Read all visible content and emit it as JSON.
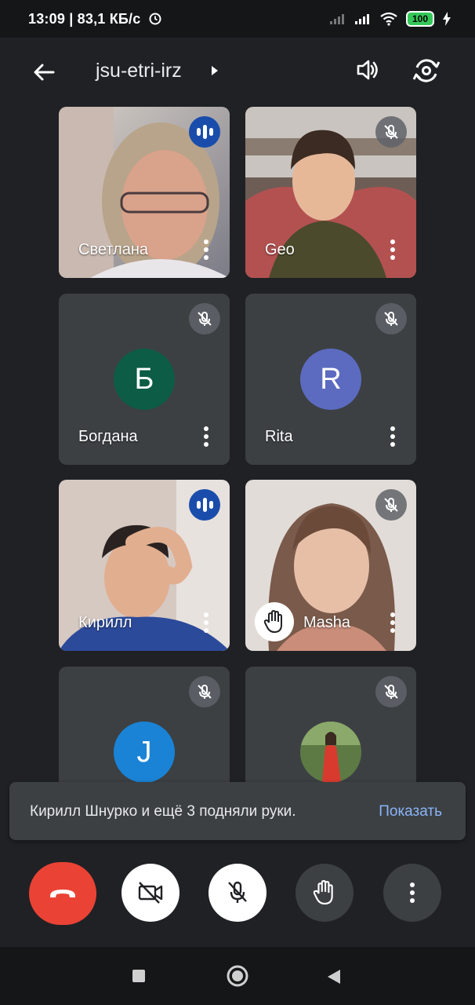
{
  "status_bar": {
    "time_speed": "13:09 | 83,1 КБ/с",
    "battery": "100"
  },
  "header": {
    "meeting_code": "jsu-etri-irz"
  },
  "participants": [
    {
      "name": "Светлана",
      "state": "speaking",
      "type": "video"
    },
    {
      "name": "Geo",
      "state": "muted",
      "type": "video"
    },
    {
      "name": "Богдана",
      "state": "muted",
      "type": "avatar",
      "initial": "Б",
      "color": "#0d5c45"
    },
    {
      "name": "Rita",
      "state": "muted",
      "type": "avatar",
      "initial": "R",
      "color": "#5c6bc0"
    },
    {
      "name": "Кирилл",
      "state": "speaking",
      "type": "video"
    },
    {
      "name": "Masha",
      "state": "muted",
      "type": "video",
      "hand_raised": true
    },
    {
      "name": "",
      "state": "muted",
      "type": "avatar",
      "initial": "J",
      "color": "#1a83d6"
    },
    {
      "name": "",
      "state": "muted",
      "type": "photo"
    }
  ],
  "toast": {
    "message": "Кирилл Шнурко и ещё 3 подняли руки.",
    "action": "Показать"
  },
  "controls": {
    "icons": [
      "end-call-icon",
      "camera-off-icon",
      "mic-off-icon",
      "raise-hand-icon",
      "more-options-icon"
    ]
  },
  "colors": {
    "background": "#202124",
    "end_call": "#ea4335",
    "speaking": "#1a4dab",
    "link": "#8ab4f8"
  }
}
